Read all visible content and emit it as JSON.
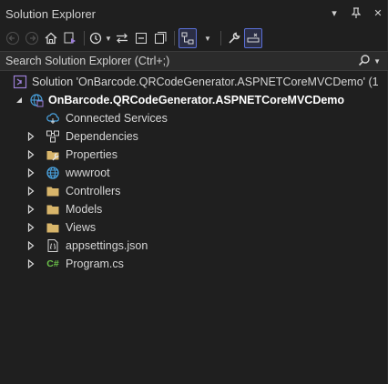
{
  "window": {
    "title": "Solution Explorer",
    "controls": {
      "dropdown": "▾",
      "pin": "⊥",
      "close": "✕"
    }
  },
  "toolbar": {
    "buttons": [
      {
        "icon": "back-arrow-icon"
      },
      {
        "icon": "forward-arrow-icon"
      },
      {
        "icon": "home-icon"
      },
      {
        "icon": "switch-views-icon"
      },
      {
        "icon": "pending-changes-filter-icon"
      },
      {
        "icon": "sync-with-active-document-icon"
      },
      {
        "icon": "collapse-all-icon"
      },
      {
        "icon": "show-all-files-icon"
      },
      {
        "icon": "view-class-diagram-icon"
      },
      {
        "icon": "properties-wrench-icon"
      },
      {
        "icon": "preview-selected-items-icon"
      }
    ]
  },
  "search": {
    "placeholder": "Search Solution Explorer (Ctrl+;)",
    "icon": "search-icon"
  },
  "tree": {
    "solution": {
      "label": "Solution 'OnBarcode.QRCodeGenerator.ASPNETCoreMVCDemo' (1",
      "icon": "solution-icon"
    },
    "project": {
      "label": "OnBarcode.QRCodeGenerator.ASPNETCoreMVCDemo",
      "icon": "web-project-icon"
    },
    "items": [
      {
        "label": "Connected Services",
        "icon": "connected-services-icon"
      },
      {
        "label": "Dependencies",
        "icon": "dependencies-icon"
      },
      {
        "label": "Properties",
        "icon": "properties-icon"
      },
      {
        "label": "wwwroot",
        "icon": "globe-icon"
      },
      {
        "label": "Controllers",
        "icon": "folder-icon"
      },
      {
        "label": "Models",
        "icon": "folder-icon"
      },
      {
        "label": "Views",
        "icon": "folder-icon"
      },
      {
        "label": "appsettings.json",
        "icon": "json-file-icon"
      },
      {
        "label": "Program.cs",
        "icon": "csharp-file-icon",
        "badge": "C#"
      }
    ]
  },
  "colors": {
    "background": "#1f1f1f",
    "accent": "#5a6fd6",
    "folder": "#d8b56a",
    "csharp": "#6cc24a",
    "globe": "#4aa3e0",
    "solution": "#9b7fd6"
  }
}
